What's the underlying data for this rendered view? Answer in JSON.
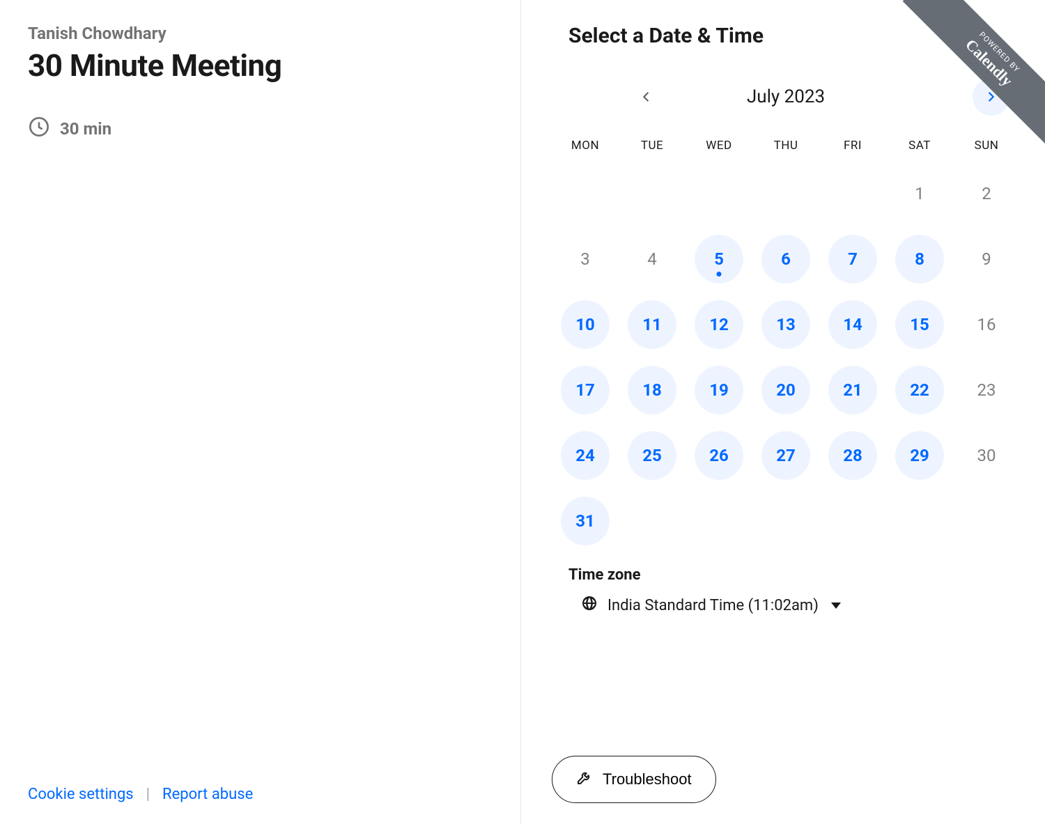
{
  "host": {
    "name": "Tanish Chowdhary"
  },
  "meeting": {
    "title": "30 Minute Meeting",
    "duration_label": "30 min"
  },
  "right": {
    "heading": "Select a Date & Time"
  },
  "calendar": {
    "month_label": "July 2023",
    "dow": [
      "MON",
      "TUE",
      "WED",
      "THU",
      "FRI",
      "SAT",
      "SUN"
    ],
    "today": 5,
    "cells": [
      {
        "d": null
      },
      {
        "d": null
      },
      {
        "d": null
      },
      {
        "d": null
      },
      {
        "d": null
      },
      {
        "d": 1,
        "a": false
      },
      {
        "d": 2,
        "a": false
      },
      {
        "d": 3,
        "a": false
      },
      {
        "d": 4,
        "a": false
      },
      {
        "d": 5,
        "a": true
      },
      {
        "d": 6,
        "a": true
      },
      {
        "d": 7,
        "a": true
      },
      {
        "d": 8,
        "a": true
      },
      {
        "d": 9,
        "a": false
      },
      {
        "d": 10,
        "a": true
      },
      {
        "d": 11,
        "a": true
      },
      {
        "d": 12,
        "a": true
      },
      {
        "d": 13,
        "a": true
      },
      {
        "d": 14,
        "a": true
      },
      {
        "d": 15,
        "a": true
      },
      {
        "d": 16,
        "a": false
      },
      {
        "d": 17,
        "a": true
      },
      {
        "d": 18,
        "a": true
      },
      {
        "d": 19,
        "a": true
      },
      {
        "d": 20,
        "a": true
      },
      {
        "d": 21,
        "a": true
      },
      {
        "d": 22,
        "a": true
      },
      {
        "d": 23,
        "a": false
      },
      {
        "d": 24,
        "a": true
      },
      {
        "d": 25,
        "a": true
      },
      {
        "d": 26,
        "a": true
      },
      {
        "d": 27,
        "a": true
      },
      {
        "d": 28,
        "a": true
      },
      {
        "d": 29,
        "a": true
      },
      {
        "d": 30,
        "a": false
      },
      {
        "d": 31,
        "a": true
      }
    ]
  },
  "timezone": {
    "label": "Time zone",
    "value": "India Standard Time (11:02am)"
  },
  "footer": {
    "cookie_settings": "Cookie settings",
    "report_abuse": "Report abuse",
    "troubleshoot": "Troubleshoot"
  },
  "badge": {
    "powered_by": "POWERED BY",
    "brand": "Calendly"
  }
}
